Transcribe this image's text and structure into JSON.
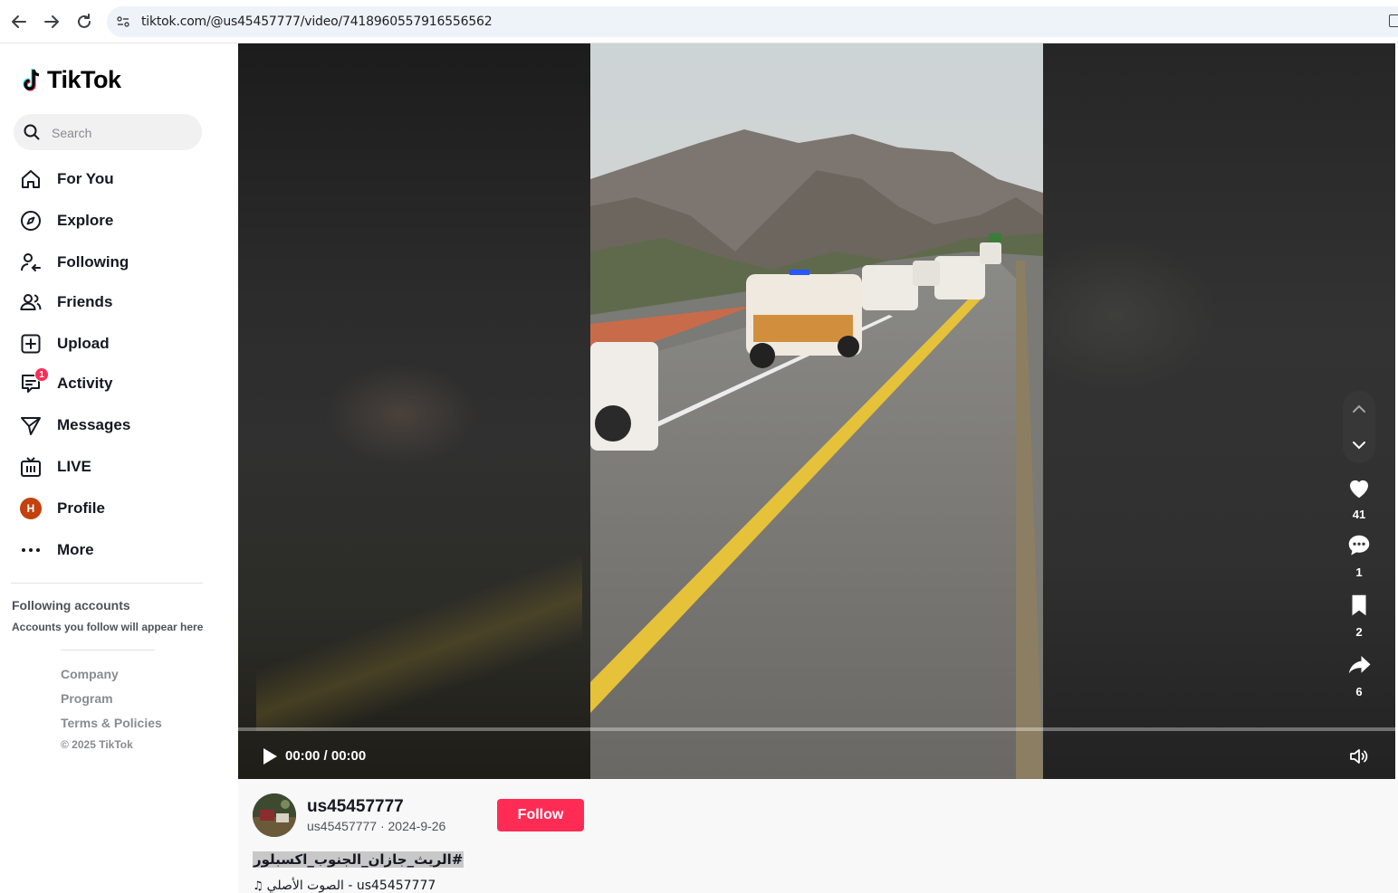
{
  "browser": {
    "url": "tiktok.com/@us45457777/video/7418960557916556562"
  },
  "sidebar": {
    "logo_text": "TikTok",
    "search_placeholder": "Search",
    "items": [
      {
        "label": "For You",
        "icon": "home-icon"
      },
      {
        "label": "Explore",
        "icon": "compass-icon"
      },
      {
        "label": "Following",
        "icon": "user-follow-icon"
      },
      {
        "label": "Friends",
        "icon": "friends-icon"
      },
      {
        "label": "Upload",
        "icon": "plus-square-icon"
      },
      {
        "label": "Activity",
        "icon": "inbox-icon",
        "badge": "1"
      },
      {
        "label": "Messages",
        "icon": "send-icon"
      },
      {
        "label": "LIVE",
        "icon": "live-tv-icon"
      },
      {
        "label": "Profile",
        "icon": "avatar",
        "avatar_letter": "H"
      },
      {
        "label": "More",
        "icon": "more-icon"
      }
    ],
    "following_title": "Following accounts",
    "following_sub": "Accounts you follow will appear here",
    "footer_links": [
      "Company",
      "Program",
      "Terms & Policies"
    ],
    "copyright": "© 2025 TikTok"
  },
  "player": {
    "time": "00:00 / 00:00",
    "progress": 0,
    "likes": "41",
    "comments": "1",
    "saves": "2",
    "shares": "6"
  },
  "post": {
    "username": "us45457777",
    "meta": "us45457777 · 2024-9-26",
    "follow_label": "Follow",
    "hashtag": "#الريث_جازان_الجنوب_اكسبلور",
    "music": "الصوت الأصلي - us45457777"
  },
  "colors": {
    "accent": "#fe2c55",
    "text": "#161823",
    "muted": "#8a8b91"
  }
}
